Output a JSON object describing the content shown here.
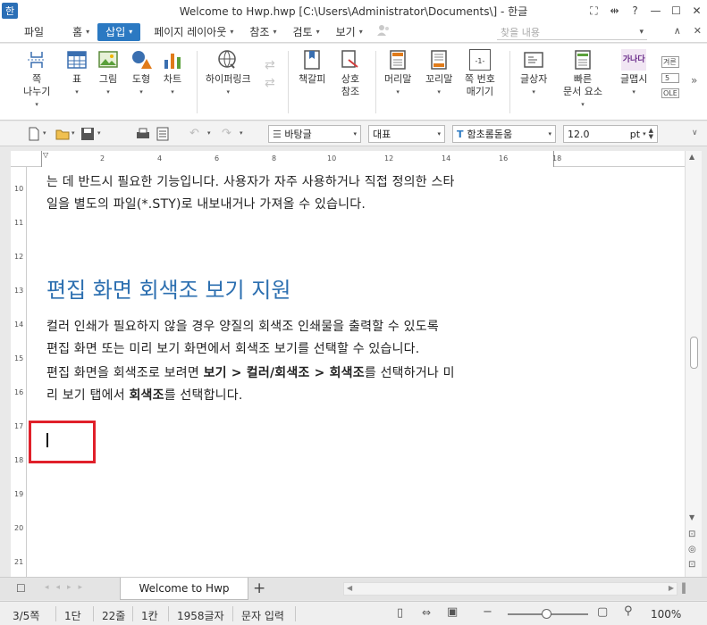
{
  "titlebar": {
    "app_icon": "한",
    "title": "Welcome to Hwp.hwp [C:\\Users\\Administrator\\Documents\\] - 한글",
    "buttons": [
      "⛶",
      "⇹",
      "?",
      "—",
      "☐",
      "✕"
    ]
  },
  "menubar": {
    "items": [
      {
        "label": "파일",
        "dropdown": false
      },
      {
        "label": "홈",
        "dropdown": true
      },
      {
        "label": "삽입",
        "dropdown": true,
        "active": true
      },
      {
        "label": "페이지 레이아웃",
        "dropdown": true
      },
      {
        "label": "참조",
        "dropdown": true
      },
      {
        "label": "검토",
        "dropdown": true
      },
      {
        "label": "보기",
        "dropdown": true
      }
    ],
    "search_placeholder": "찾을 내용",
    "right_icons": [
      "▾",
      "∧",
      "✕"
    ]
  },
  "ribbon": {
    "buttons": [
      {
        "label": "쪽\n나누기",
        "dropdown": true
      },
      {
        "label": "표",
        "dropdown": true
      },
      {
        "label": "그림",
        "dropdown": true
      },
      {
        "label": "도형",
        "dropdown": true
      },
      {
        "label": "차트",
        "dropdown": true
      },
      {
        "label": "하이퍼링크",
        "dropdown": true
      },
      {
        "label": "책갈피",
        "dropdown": false
      },
      {
        "label": "상호\n참조",
        "dropdown": false
      },
      {
        "label": "머리말",
        "dropdown": true
      },
      {
        "label": "꼬리말",
        "dropdown": true
      },
      {
        "label": "쪽 번호\n매기기",
        "dropdown": false
      },
      {
        "label": "글상자",
        "dropdown": true
      },
      {
        "label": "빠른\n문서 요소",
        "dropdown": true
      },
      {
        "label": "글맵시",
        "dropdown": true
      }
    ],
    "icon_text": {
      "page_number": "-1-",
      "textbox": "가나다",
      "wordart": "가나다"
    },
    "side_labels": [
      "겨른",
      "5",
      "OLE"
    ]
  },
  "toolbar": {
    "style": "바탕글",
    "lang": "대표",
    "font_icon": "T",
    "font": "함초롬돋움",
    "size": "12.0",
    "unit": "pt"
  },
  "ruler": {
    "h_ticks": [
      "2",
      "4",
      "6",
      "8",
      "10",
      "12",
      "14",
      "16",
      "18"
    ],
    "v_ticks": [
      "10",
      "11",
      "12",
      "13",
      "14",
      "15",
      "16",
      "17",
      "18",
      "19",
      "20",
      "21"
    ]
  },
  "document": {
    "para1_line1": "는 데 반드시 필요한 기능입니다. 사용자가 자주 사용하거나 직접 정의한 스타",
    "para1_line2": "일을 별도의 파일(*.STY)로 내보내거나 가져올 수 있습니다.",
    "heading": "편집 화면 회색조 보기 지원",
    "para2_line1": "컬러 인쇄가 필요하지 않을 경우 양질의 회색조 인쇄물을 출력할 수 있도록",
    "para2_line2": "편집 화면 또는 미리 보기 화면에서 회색조 보기를 선택할 수 있습니다.",
    "para3_line1_a": "편집 화면을 회색조로 보려면 ",
    "para3_line1_b": "보기 > 컬러/회색조 > 회색조",
    "para3_line1_c": "를 선택하거나 미",
    "para3_line2_a": "리 보기 탭에서 ",
    "para3_line2_b": "회색조",
    "para3_line2_c": "를 선택합니다."
  },
  "tabs": {
    "doc_tab": "Welcome to Hwp",
    "add": "+"
  },
  "statusbar": {
    "page": "3/5쪽",
    "section": "1단",
    "line": "22줄",
    "col": "1칸",
    "chars": "1958글자",
    "mode": "문자 입력",
    "zoom": "100%"
  },
  "colors": {
    "accent": "#2b79c2",
    "heading": "#2c6fb0",
    "highlight_box": "#e0202a"
  }
}
